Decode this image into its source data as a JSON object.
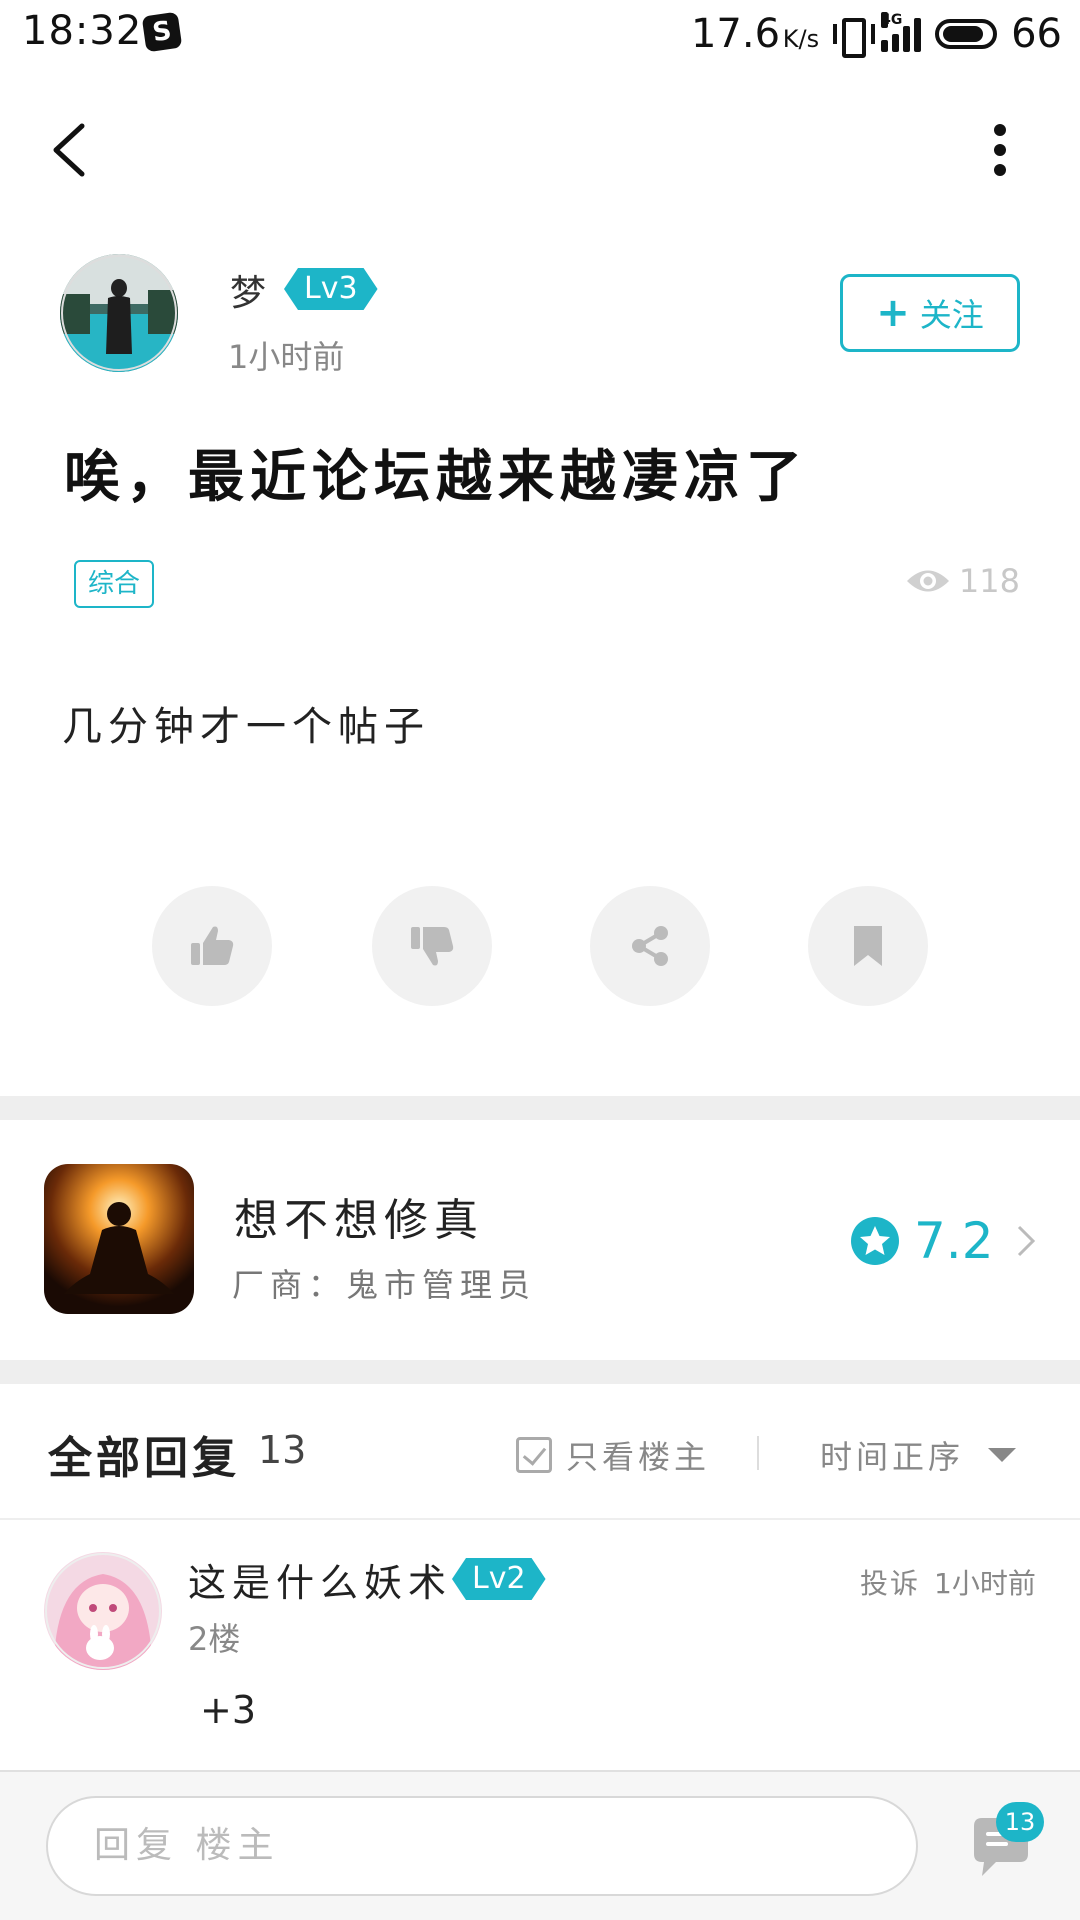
{
  "status_bar": {
    "time": "18:32",
    "app_icon": "S",
    "net_speed": "17.6",
    "net_speed_unit": "K/s",
    "network_tag": "4G",
    "battery": "66"
  },
  "post": {
    "author": {
      "name": "梦",
      "level": "Lv3",
      "time": "1小时前"
    },
    "follow_label": "关注",
    "title": "唉，最近论坛越来越凄凉了",
    "tag": "综合",
    "views": "118",
    "body": "几分钟才一个帖子"
  },
  "game": {
    "name": "想不想修真",
    "vendor": "厂商：鬼市管理员",
    "rating": "7.2"
  },
  "replies_header": {
    "title": "全部回复",
    "count": "13",
    "only_op": "只看楼主",
    "sort": "时间正序"
  },
  "replies": [
    {
      "user": "这是什么妖术",
      "level": "Lv2",
      "floor": "2楼",
      "report": "投诉",
      "time": "1小时前",
      "content": "+3"
    }
  ],
  "bottom_bar": {
    "placeholder": "回复  楼主",
    "comment_count": "13"
  },
  "colors": {
    "accent": "#1db5c8",
    "divider": "#eeeeee"
  }
}
